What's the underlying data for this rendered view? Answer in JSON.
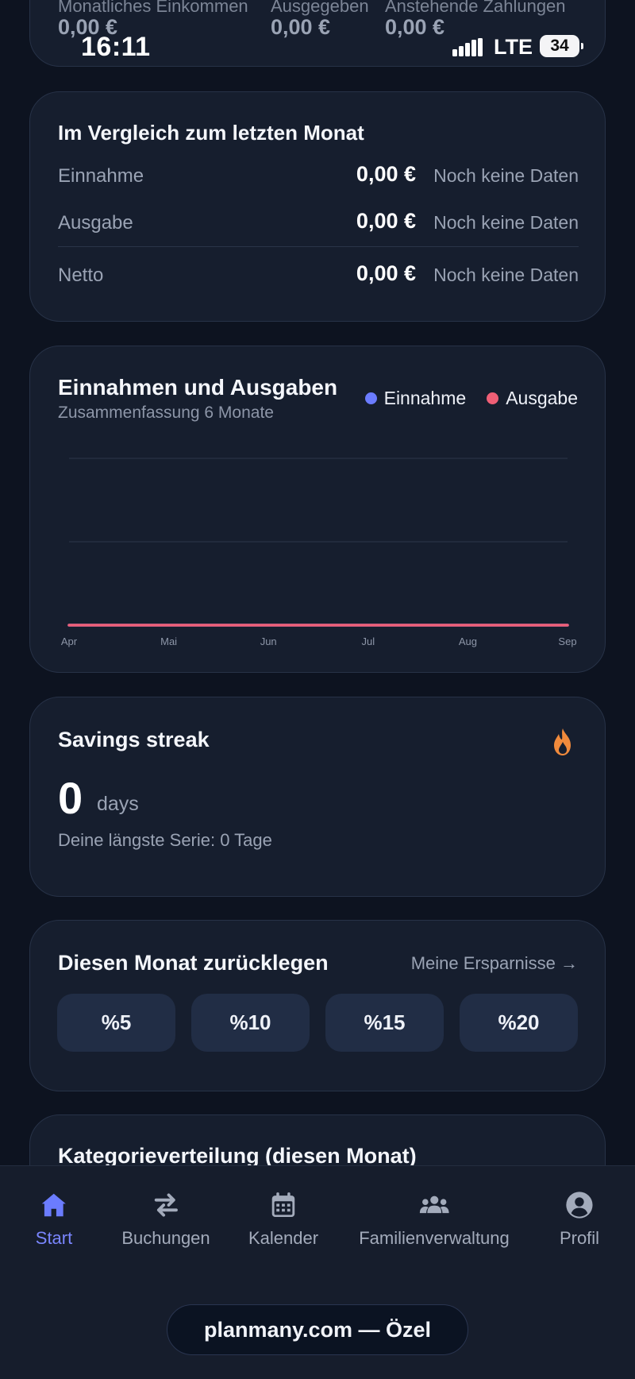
{
  "status_bar": {
    "time": "16:11",
    "network": "LTE",
    "battery": "34"
  },
  "summary": {
    "labels": [
      "Monatliches Einkommen",
      "Ausgegeben",
      "Anstehende Zahlungen"
    ],
    "values": [
      "0,00 €",
      "0,00 €",
      "0,00 €"
    ]
  },
  "comparison": {
    "title": "Im Vergleich zum letzten Monat",
    "rows": [
      {
        "label": "Einnahme",
        "value": "0,00 €",
        "note": "Noch keine Daten"
      },
      {
        "label": "Ausgabe",
        "value": "0,00 €",
        "note": "Noch keine Daten"
      },
      {
        "label": "Netto",
        "value": "0,00 €",
        "note": "Noch keine Daten"
      }
    ]
  },
  "income_expense_chart": {
    "title": "Einnahmen und Ausgaben",
    "subtitle": "Zusammenfassung 6 Monate",
    "legend": [
      {
        "label": "Einnahme",
        "color": "#6b7cff"
      },
      {
        "label": "Ausgabe",
        "color": "#ef5f76"
      }
    ]
  },
  "chart_data": {
    "type": "line",
    "title": "Einnahmen und Ausgaben",
    "subtitle": "Zusammenfassung 6 Monate",
    "categories": [
      "Apr",
      "Mai",
      "Jun",
      "Jul",
      "Aug",
      "Sep"
    ],
    "series": [
      {
        "name": "Einnahme",
        "color": "#6b7cff",
        "values": [
          0,
          0,
          0,
          0,
          0,
          0
        ]
      },
      {
        "name": "Ausgabe",
        "color": "#ef5f76",
        "values": [
          0,
          0,
          0,
          0,
          0,
          0
        ]
      }
    ],
    "ylim": [
      0,
      1
    ],
    "grid": true,
    "legend": "top-right"
  },
  "streak": {
    "title": "Savings streak",
    "count": "0",
    "unit": "days",
    "longest": "Deine längste Serie: 0 Tage",
    "icon": "flame-icon",
    "icon_color": "#f08a3c"
  },
  "savings": {
    "title": "Diesen Monat zurücklegen",
    "link": "Meine Ersparnisse →",
    "options": [
      "%5",
      "%10",
      "%15",
      "%20"
    ]
  },
  "category": {
    "title": "Kategorieverteilung (diesen Monat)"
  },
  "nav": {
    "items": [
      {
        "label": "Start",
        "icon": "home-icon",
        "active": true
      },
      {
        "label": "Buchungen",
        "icon": "swap-arrows-icon"
      },
      {
        "label": "Kalender",
        "icon": "calendar-icon"
      },
      {
        "label": "Familienverwaltung",
        "icon": "family-icon"
      },
      {
        "label": "Profil",
        "icon": "user-circle-icon"
      }
    ],
    "accent": "#6b7cff"
  },
  "footer_pill": "planmany.com — Özel"
}
